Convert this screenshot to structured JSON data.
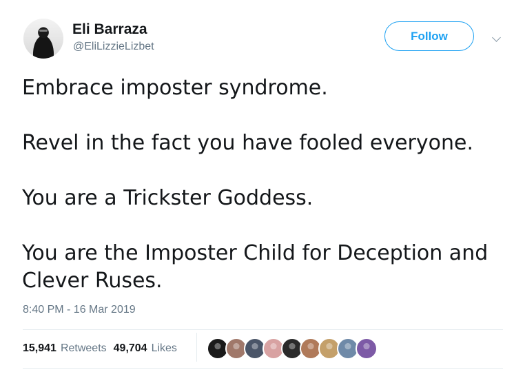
{
  "user": {
    "name": "Eli Barraza",
    "handle": "@EliLizzieLizbet",
    "follow_label": "Follow"
  },
  "tweet": {
    "paragraphs": [
      "Embrace imposter syndrome.",
      "Revel in the fact you have fooled everyone.",
      "You are a Trickster Goddess.",
      "You are the Imposter Child for Deception and Clever Ruses."
    ],
    "timestamp": "8:40 PM - 16 Mar 2019"
  },
  "stats": {
    "retweets_count": "15,941",
    "retweets_label": "Retweets",
    "likes_count": "49,704",
    "likes_label": "Likes"
  },
  "likers": {
    "colors": [
      "#1a1a1a",
      "#a0786a",
      "#4a5568",
      "#d8a2a2",
      "#2b2b2b",
      "#b07a5a",
      "#c4a06a",
      "#6f8aa8",
      "#7d5aa6"
    ]
  },
  "colors": {
    "accent": "#1da1f2",
    "secondary_text": "#657786",
    "primary_text": "#14171a"
  }
}
